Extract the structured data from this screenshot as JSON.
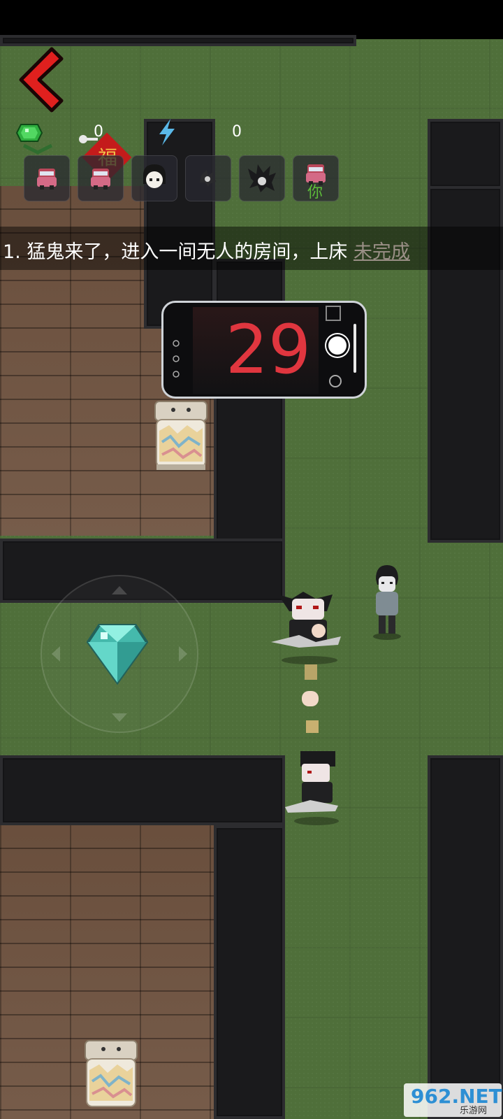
{
  "hud": {
    "gem_count": "0",
    "energy_count": "0",
    "fu_label": "福",
    "slots": [
      {
        "icon": "car-icon",
        "label": ""
      },
      {
        "icon": "car-icon",
        "label": ""
      },
      {
        "icon": "girl-face-icon",
        "label": ""
      },
      {
        "icon": "shadow-creature-icon",
        "label": ""
      },
      {
        "icon": "spiky-creature-icon",
        "label": ""
      },
      {
        "icon": "car-icon",
        "label": "你"
      }
    ]
  },
  "quest": {
    "text": "1. 猛鬼来了，进入一间无人的房间，上床",
    "status": "未完成"
  },
  "timer": {
    "value": "29"
  },
  "watermark": {
    "text": "962.NET",
    "sub": "乐游网"
  },
  "colors": {
    "grass": "#4f6f3a",
    "wood": "#6f5340",
    "wall": "#1a1a1c",
    "timer": "#e0363f",
    "back_arrow": "#e0201e",
    "diamond": "#5fd6c8"
  }
}
